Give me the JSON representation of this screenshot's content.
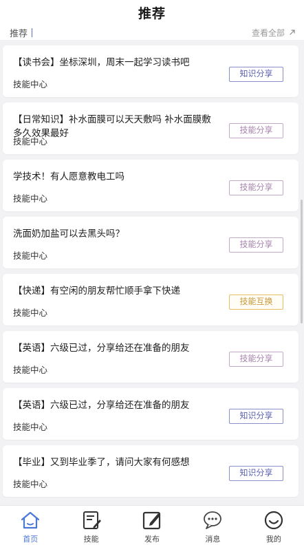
{
  "header": {
    "title": "推荐"
  },
  "section": {
    "label": "推荐",
    "see_all": "查看全部"
  },
  "feed": [
    {
      "title": "【读书会】坐标深圳，周末一起学习读书吧",
      "subtitle": "技能中心",
      "tag": "知识分享",
      "tag_style": "indigo"
    },
    {
      "title": "【日常知识】补水面膜可以天天敷吗 补水面膜敷多久效果最好",
      "subtitle": "技能中心",
      "tag": "技能分享",
      "tag_style": "purple"
    },
    {
      "title": "学技术！有人愿意教电工吗",
      "subtitle": "技能中心",
      "tag": "技能分享",
      "tag_style": "purple"
    },
    {
      "title": "洗面奶加盐可以去黑头吗？",
      "subtitle": "技能中心",
      "tag": "技能分享",
      "tag_style": "purple"
    },
    {
      "title": "【快递】有空闲的朋友帮忙顺手拿下快递",
      "subtitle": "技能中心",
      "tag": "技能互换",
      "tag_style": "gold"
    },
    {
      "title": "【英语】六级已过，分享给还在准备的朋友",
      "subtitle": "技能中心",
      "tag": "技能分享",
      "tag_style": "purple"
    },
    {
      "title": "【英语】六级已过，分享给还在准备的朋友",
      "subtitle": "技能中心",
      "tag": "知识分享",
      "tag_style": "indigo"
    },
    {
      "title": "【毕业】又到毕业季了，请问大家有何感想",
      "subtitle": "技能中心",
      "tag": "知识分享",
      "tag_style": "indigo"
    }
  ],
  "tabs": [
    {
      "label": "首页",
      "icon": "home-icon",
      "active": true
    },
    {
      "label": "技能",
      "icon": "edit-note-icon",
      "active": false
    },
    {
      "label": "发布",
      "icon": "publish-icon",
      "active": false
    },
    {
      "label": "消息",
      "icon": "message-icon",
      "active": false
    },
    {
      "label": "我的",
      "icon": "profile-icon",
      "active": false
    }
  ],
  "colors": {
    "accent": "#4a78d6",
    "tag_indigo": "#5c62ad",
    "tag_purple": "#a783ad",
    "tag_gold": "#c99a3c"
  }
}
